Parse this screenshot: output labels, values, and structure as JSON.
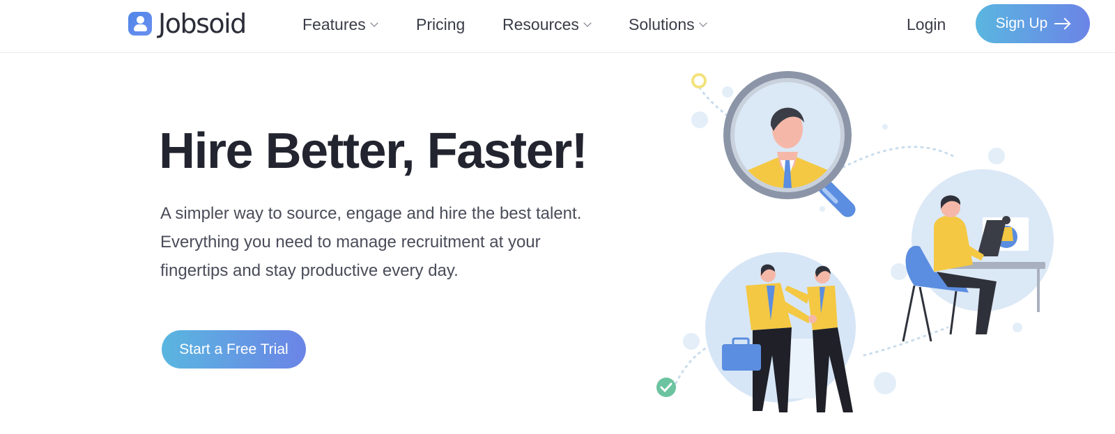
{
  "brand": {
    "name": "Jobsoid",
    "logo_icon": "person-badge-icon"
  },
  "nav": {
    "items": [
      {
        "label": "Features",
        "has_dropdown": true
      },
      {
        "label": "Pricing",
        "has_dropdown": false
      },
      {
        "label": "Resources",
        "has_dropdown": true
      },
      {
        "label": "Solutions",
        "has_dropdown": true
      }
    ],
    "login_label": "Login",
    "signup_label": "Sign Up",
    "signup_icon": "arrow-right-icon"
  },
  "hero": {
    "title": "Hire Better, Faster!",
    "subtitle": "A simpler way to source, engage and hire the best talent. Everything you need to manage recruitment at your fingertips and stay productive every day.",
    "cta_label": "Start a Free Trial"
  },
  "colors": {
    "accent_start": "#5ab6e0",
    "accent_end": "#6b84e6",
    "heading": "#22242f",
    "body_text": "#4a4c59",
    "illustration_yellow": "#f4c842",
    "illustration_blue": "#5b8de0"
  }
}
